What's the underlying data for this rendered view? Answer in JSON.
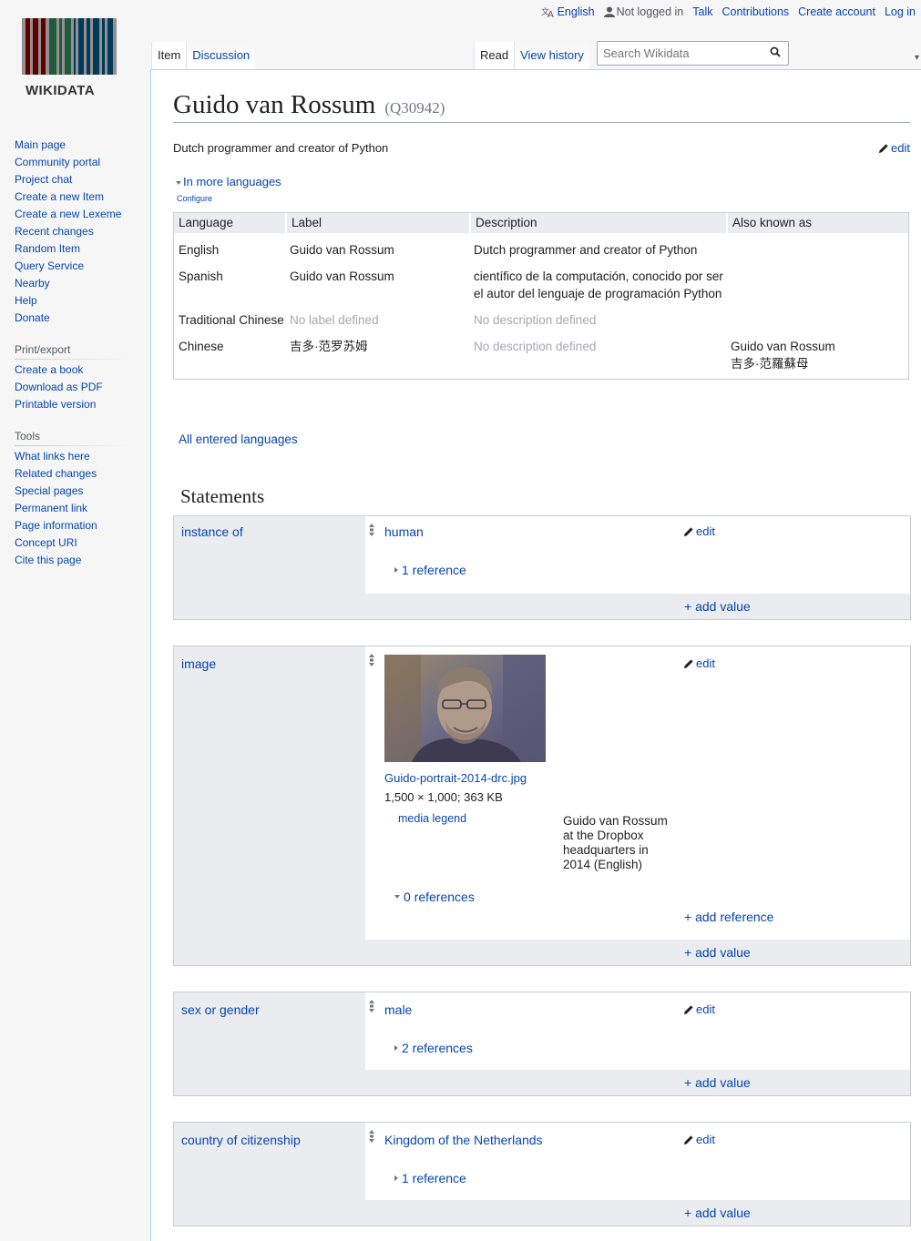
{
  "personal": {
    "language": "English",
    "not_logged_in": "Not logged in",
    "talk": "Talk",
    "contributions": "Contributions",
    "create_account": "Create account",
    "log_in": "Log in"
  },
  "logo": {
    "wordmark": "WIKIDATA",
    "bar_color": "#3d2a2a"
  },
  "sidebar": {
    "navigation": [
      "Main page",
      "Community portal",
      "Project chat",
      "Create a new Item",
      "Create a new Lexeme",
      "Recent changes",
      "Random Item",
      "Query Service",
      "Nearby",
      "Help",
      "Donate"
    ],
    "print_heading": "Print/export",
    "print": [
      "Create a book",
      "Download as PDF",
      "Printable version"
    ],
    "tools_heading": "Tools",
    "tools": [
      "What links here",
      "Related changes",
      "Special pages",
      "Permanent link",
      "Page information",
      "Concept URI",
      "Cite this page"
    ]
  },
  "tabs": {
    "item": "Item",
    "discussion": "Discussion",
    "read": "Read",
    "history": "View history"
  },
  "search": {
    "placeholder": "Search Wikidata"
  },
  "page": {
    "title": "Guido van Rossum",
    "qid": "(Q30942)",
    "description": "Dutch programmer and creator of Python",
    "edit": "edit",
    "in_more_languages": "In more languages",
    "configure": "Configure",
    "all_languages": "All entered languages",
    "statements_heading": "Statements"
  },
  "languages": {
    "headers": [
      "Language",
      "Label",
      "Description",
      "Also known as"
    ],
    "rows": [
      {
        "lang": "English",
        "label": "Guido van Rossum",
        "desc": "Dutch programmer and creator of Python",
        "aka": ""
      },
      {
        "lang": "Spanish",
        "label": "Guido van Rossum",
        "desc": "científico de la computación, conocido por ser el autor del lenguaje de programación Python",
        "aka": ""
      },
      {
        "lang": "Traditional Chinese",
        "label": "No label defined",
        "desc": "No description defined",
        "aka": ""
      },
      {
        "lang": "Chinese",
        "label": "吉多·范罗苏姆",
        "desc": "No description defined",
        "aka": "Guido van Rossum\n吉多·范羅蘇母"
      }
    ]
  },
  "statements": {
    "instance_of": {
      "property": "instance of",
      "value": "human",
      "refs": "1 reference",
      "edit": "edit",
      "add_value": "+ add value"
    },
    "image": {
      "property": "image",
      "file": "Guido-portrait-2014-drc.jpg",
      "meta": "1,500 × 1,000; 363 KB",
      "legend_label": "media legend",
      "legend_value": "Guido van Rossum at the Dropbox headquarters in 2014 (English)",
      "refs": "0 references",
      "add_reference": "+ add reference",
      "edit": "edit",
      "add_value": "+ add value"
    },
    "sex_or_gender": {
      "property": "sex or gender",
      "value": "male",
      "refs": "2 references",
      "edit": "edit",
      "add_value": "+ add value"
    },
    "citizenship": {
      "property": "country of citizenship",
      "value": "Kingdom of the Netherlands",
      "refs": "1 reference",
      "edit": "edit",
      "add_value": "+ add value"
    }
  }
}
